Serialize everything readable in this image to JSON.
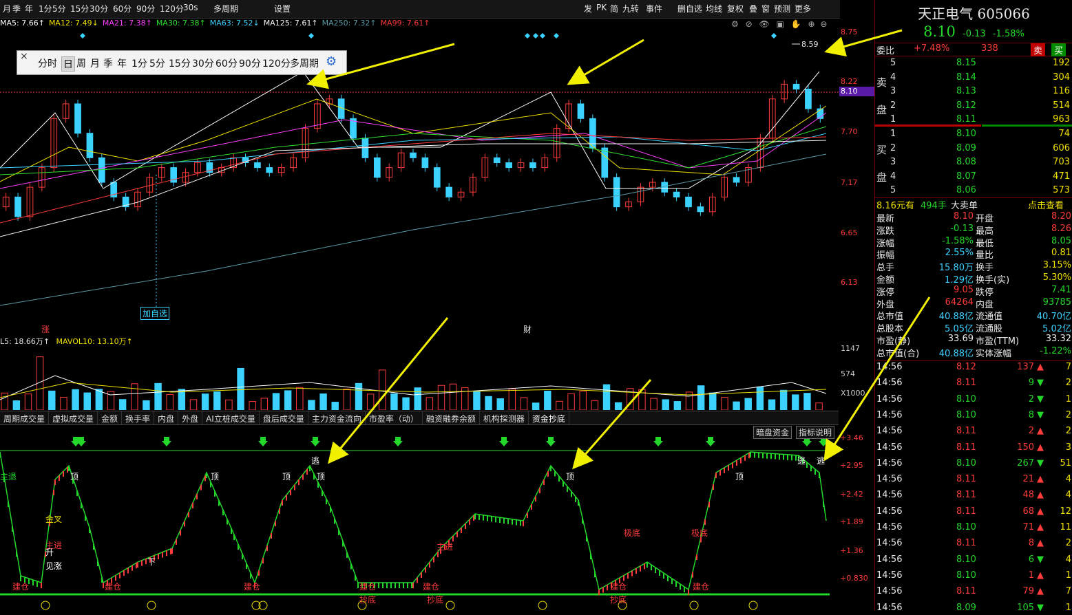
{
  "topbar": {
    "left_items": [
      "月",
      "季",
      "年",
      "1分",
      "5分",
      "15分",
      "30分",
      "60分",
      "90分",
      "120分",
      "30s",
      "多周期",
      "设置"
    ],
    "right_items": [
      "发",
      "PK",
      "简",
      "九转",
      "事件",
      "删自选",
      "均线",
      "复权",
      "叠",
      "窗",
      "预测",
      "更多"
    ]
  },
  "ma_bar": [
    {
      "label": "MA5: 7.66↑",
      "color": "#ffffff"
    },
    {
      "label": "MA12: 7.49↓",
      "color": "#f0e000"
    },
    {
      "label": "MA21: 7.38↑",
      "color": "#ff40ff"
    },
    {
      "label": "MA30: 7.38↑",
      "color": "#30e030"
    },
    {
      "label": "MA63: 7.52↓",
      "color": "#3cd2ff"
    },
    {
      "label": "MA125: 7.61↑",
      "color": "#f5f5f5"
    },
    {
      "label": "MA250: 7.32↑",
      "color": "#5a9aa8"
    },
    {
      "label": "MA99: 7.61↑",
      "color": "#ff3b3b"
    }
  ],
  "popup": {
    "close": "×",
    "items": [
      "分时",
      "日",
      "周",
      "月",
      "季",
      "年",
      "1分",
      "5分",
      "15分",
      "30分",
      "60分",
      "90分",
      "120分",
      "多周期"
    ],
    "selected": "日"
  },
  "price_axis": [
    "8.75",
    "8.22",
    "7.70",
    "7.17",
    "6.65",
    "6.13"
  ],
  "current_price_tag": "8.10",
  "high_label": "8.59",
  "add_watch_label": "加自选",
  "event_markers": [
    "涨",
    "财"
  ],
  "volume": {
    "label_left": "L5: 18.66万↑",
    "label_mavol": "MAVOL10: 13.10万↑",
    "axis": [
      "1147",
      "574",
      "X1000"
    ]
  },
  "indicator_tabs": [
    "周期成交量",
    "虚拟成交量",
    "金额",
    "换手率",
    "内盘",
    "外盘",
    "AI立桩成交量",
    "盘后成交量",
    "主力资金流向",
    "市盈率（动）",
    "融资融券余额",
    "机构探测器",
    "资金抄底"
  ],
  "indicator_buttons": [
    "暗盘资金",
    "指标说明"
  ],
  "indicator_axis": [
    "3.46",
    "2.95",
    "2.42",
    "1.89",
    "1.36",
    "0.830"
  ],
  "indicator_labels": {
    "left": [
      "主退",
      "金叉",
      "主进",
      "升",
      "见涨"
    ],
    "build": "建仓",
    "bottom": "抄底",
    "top": "顶",
    "escape": "逃",
    "down": "下",
    "extreme": "极底",
    "main_in": "主进"
  },
  "stock": {
    "name": "天正电气",
    "code": "605066",
    "price": "8.10",
    "change": "-0.13",
    "pct": "-1.58%"
  },
  "order_ratio": {
    "label": "委比",
    "ratio": "+7.48%",
    "diff": "338",
    "buy": "买",
    "sell": "卖"
  },
  "asks": [
    {
      "lvl": "5",
      "price": "8.15",
      "vol": "192"
    },
    {
      "lvl": "4",
      "price": "8.14",
      "vol": "304"
    },
    {
      "lvl": "3",
      "price": "8.13",
      "vol": "116"
    },
    {
      "lvl": "2",
      "price": "8.12",
      "vol": "514"
    },
    {
      "lvl": "1",
      "price": "8.11",
      "vol": "963"
    }
  ],
  "bids": [
    {
      "lvl": "1",
      "price": "8.10",
      "vol": "74"
    },
    {
      "lvl": "2",
      "price": "8.09",
      "vol": "606"
    },
    {
      "lvl": "3",
      "price": "8.08",
      "vol": "703"
    },
    {
      "lvl": "4",
      "price": "8.07",
      "vol": "471"
    },
    {
      "lvl": "5",
      "price": "8.06",
      "vol": "573"
    }
  ],
  "sell_side": "卖盘",
  "buy_side": "买盘",
  "big_order": {
    "a": "8.16元有",
    "b": "494手",
    "c": "大卖单",
    "d": "点击查看"
  },
  "stats": [
    {
      "k1": "最新",
      "v1": "8.10",
      "c1": "#ff3b3b",
      "k2": "开盘",
      "v2": "8.20",
      "c2": "#ff3b3b"
    },
    {
      "k1": "涨跌",
      "v1": "-0.13",
      "c1": "#23d82a",
      "k2": "最高",
      "v2": "8.26",
      "c2": "#ff3b3b"
    },
    {
      "k1": "涨幅",
      "v1": "-1.58%",
      "c1": "#23d82a",
      "k2": "最低",
      "v2": "8.05",
      "c2": "#23d82a"
    },
    {
      "k1": "振幅",
      "v1": "2.55%",
      "c1": "#3cd2ff",
      "k2": "量比",
      "v2": "0.81",
      "c2": "#f0e000"
    },
    {
      "k1": "总手",
      "v1": "15.80万",
      "c1": "#3cd2ff",
      "k2": "换手",
      "v2": "3.15%",
      "c2": "#f0e000"
    },
    {
      "k1": "金额",
      "v1": "1.29亿",
      "c1": "#3cd2ff",
      "k2": "换手(实)",
      "v2": "5.30%",
      "c2": "#f0e000"
    },
    {
      "k1": "涨停",
      "v1": "9.05",
      "c1": "#ff3b3b",
      "k2": "跌停",
      "v2": "7.41",
      "c2": "#23d82a"
    },
    {
      "k1": "外盘",
      "v1": "64264",
      "c1": "#ff3b3b",
      "k2": "内盘",
      "v2": "93785",
      "c2": "#23d82a"
    },
    {
      "k1": "总市值",
      "v1": "40.88亿",
      "c1": "#3cd2ff",
      "k2": "流通值",
      "v2": "40.70亿",
      "c2": "#3cd2ff"
    },
    {
      "k1": "总股本",
      "v1": "5.05亿",
      "c1": "#3cd2ff",
      "k2": "流通股",
      "v2": "5.02亿",
      "c2": "#3cd2ff"
    },
    {
      "k1": "市盈(静)",
      "v1": "33.69",
      "c1": "#e8e8e8",
      "k2": "市盈(TTM)",
      "v2": "33.32",
      "c2": "#e8e8e8"
    },
    {
      "k1": "总市值(合)",
      "v1": "40.88亿",
      "c1": "#3cd2ff",
      "k2": "实体涨幅",
      "v2": "-1.22%",
      "c2": "#23d82a"
    }
  ],
  "ticks": [
    {
      "t": "14:56",
      "p": "8.12",
      "v": "137",
      "d": "up",
      "n": "7"
    },
    {
      "t": "14:56",
      "p": "8.11",
      "v": "9",
      "d": "dn",
      "n": "2"
    },
    {
      "t": "14:56",
      "p": "8.10",
      "v": "2",
      "d": "dn",
      "n": "1"
    },
    {
      "t": "14:56",
      "p": "8.10",
      "v": "8",
      "d": "dn",
      "n": "2"
    },
    {
      "t": "14:56",
      "p": "8.11",
      "v": "2",
      "d": "up",
      "n": "2"
    },
    {
      "t": "14:56",
      "p": "8.11",
      "v": "150",
      "d": "up",
      "n": "3"
    },
    {
      "t": "14:56",
      "p": "8.10",
      "v": "267",
      "d": "dn",
      "n": "51"
    },
    {
      "t": "14:56",
      "p": "8.11",
      "v": "21",
      "d": "up",
      "n": "4"
    },
    {
      "t": "14:56",
      "p": "8.11",
      "v": "48",
      "d": "up",
      "n": "4"
    },
    {
      "t": "14:56",
      "p": "8.11",
      "v": "68",
      "d": "up",
      "n": "12"
    },
    {
      "t": "14:56",
      "p": "8.10",
      "v": "71",
      "d": "up",
      "n": "11"
    },
    {
      "t": "14:56",
      "p": "8.11",
      "v": "8",
      "d": "up",
      "n": "2"
    },
    {
      "t": "14:56",
      "p": "8.10",
      "v": "6",
      "d": "dn",
      "n": "4"
    },
    {
      "t": "14:56",
      "p": "8.10",
      "v": "1",
      "d": "up",
      "n": "1"
    },
    {
      "t": "14:56",
      "p": "8.11",
      "v": "79",
      "d": "up",
      "n": "7"
    },
    {
      "t": "14:56",
      "p": "8.09",
      "v": "105",
      "d": "dn",
      "n": "1"
    }
  ],
  "chart_data": {
    "type": "candlestick",
    "ylim": [
      5.9,
      9.0
    ],
    "price_open_close": [
      [
        7.2,
        7.3
      ],
      [
        7.3,
        7.1
      ],
      [
        7.1,
        7.4
      ],
      [
        7.4,
        7.6
      ],
      [
        7.6,
        8.1
      ],
      [
        8.1,
        8.25
      ],
      [
        8.25,
        7.95
      ],
      [
        7.95,
        7.7
      ],
      [
        7.7,
        7.45
      ],
      [
        7.45,
        7.3
      ],
      [
        7.3,
        7.2
      ],
      [
        7.2,
        7.35
      ],
      [
        7.35,
        7.5
      ],
      [
        7.5,
        7.6
      ],
      [
        7.6,
        7.45
      ],
      [
        7.45,
        7.55
      ],
      [
        7.55,
        7.65
      ],
      [
        7.65,
        7.55
      ],
      [
        7.55,
        7.6
      ],
      [
        7.6,
        7.7
      ],
      [
        7.7,
        7.65
      ],
      [
        7.65,
        7.6
      ],
      [
        7.6,
        7.55
      ],
      [
        7.55,
        7.6
      ],
      [
        7.6,
        7.7
      ],
      [
        7.7,
        8.0
      ],
      [
        8.0,
        8.25
      ],
      [
        8.25,
        8.3
      ],
      [
        8.3,
        8.1
      ],
      [
        8.1,
        7.9
      ],
      [
        7.9,
        7.7
      ],
      [
        7.7,
        7.5
      ],
      [
        7.5,
        7.6
      ],
      [
        7.6,
        7.75
      ],
      [
        7.75,
        7.7
      ],
      [
        7.7,
        7.6
      ],
      [
        7.6,
        7.4
      ],
      [
        7.4,
        7.3
      ],
      [
        7.3,
        7.35
      ],
      [
        7.35,
        7.5
      ],
      [
        7.5,
        7.7
      ],
      [
        7.7,
        7.65
      ],
      [
        7.65,
        7.6
      ],
      [
        7.6,
        7.65
      ],
      [
        7.65,
        7.6
      ],
      [
        7.6,
        7.7
      ],
      [
        7.7,
        8.0
      ],
      [
        8.0,
        8.25
      ],
      [
        8.25,
        8.1
      ],
      [
        8.1,
        7.8
      ],
      [
        7.8,
        7.5
      ],
      [
        7.5,
        7.2
      ],
      [
        7.2,
        7.25
      ],
      [
        7.25,
        7.4
      ],
      [
        7.4,
        7.45
      ],
      [
        7.45,
        7.35
      ],
      [
        7.35,
        7.3
      ],
      [
        7.3,
        7.2
      ],
      [
        7.2,
        7.15
      ],
      [
        7.15,
        7.3
      ],
      [
        7.3,
        7.5
      ],
      [
        7.5,
        7.45
      ],
      [
        7.45,
        7.6
      ],
      [
        7.6,
        7.9
      ],
      [
        7.9,
        8.3
      ],
      [
        8.3,
        8.45
      ],
      [
        8.45,
        8.4
      ],
      [
        8.4,
        8.2
      ],
      [
        8.2,
        8.1
      ]
    ]
  }
}
